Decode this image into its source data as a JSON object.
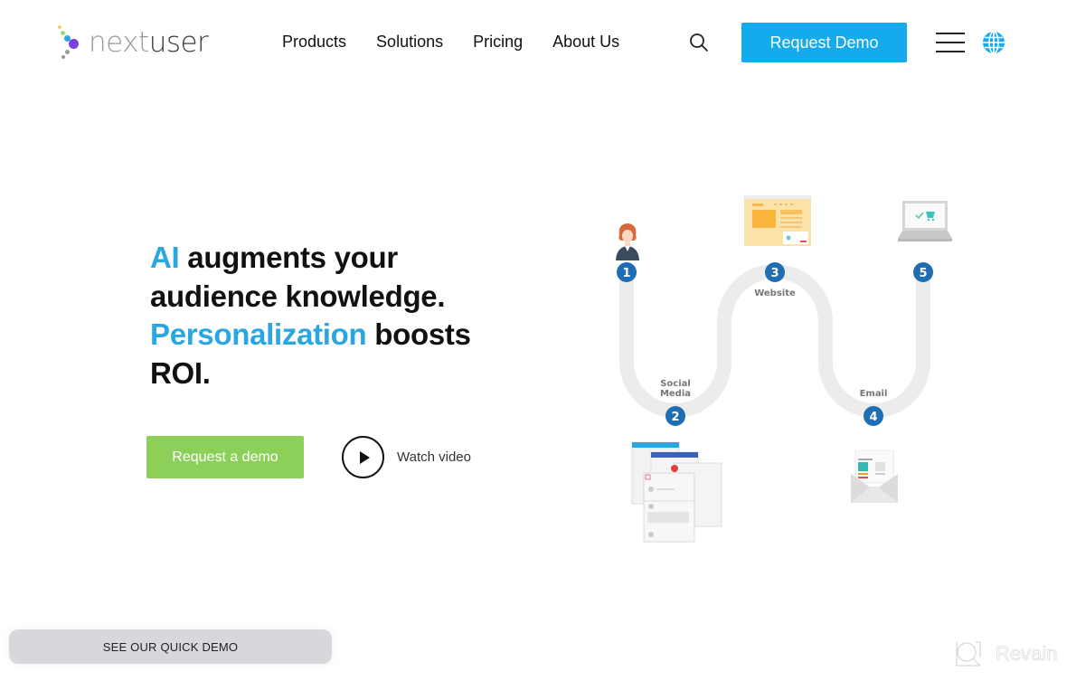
{
  "brand": {
    "name_part1": "next",
    "name_part2": "user",
    "dot_colors": [
      "#f6c343",
      "#8cd05a",
      "#2aa6e0",
      "#7b3fe4",
      "#9a9a9a",
      "#9a9a9a"
    ]
  },
  "header": {
    "nav": [
      {
        "label": "Products"
      },
      {
        "label": "Solutions"
      },
      {
        "label": "Pricing"
      },
      {
        "label": "About Us"
      }
    ],
    "search_icon": "search-icon",
    "request_demo_label": "Request Demo",
    "menu_icon": "hamburger-menu-icon",
    "language_icon": "globe-icon"
  },
  "hero": {
    "title_parts": [
      {
        "text": "AI",
        "accent": true
      },
      {
        "text": " augments your audience knowledge. ",
        "accent": false
      },
      {
        "text": "Personalization",
        "accent": true
      },
      {
        "text": " boosts ROI.",
        "accent": false
      }
    ],
    "cta_label": "Request a demo",
    "watch_label": "Watch video"
  },
  "journey": {
    "steps": [
      {
        "number": "1",
        "label": "",
        "illustration": "person-icon"
      },
      {
        "number": "2",
        "label": "Social Media",
        "illustration": "social-feeds-icon"
      },
      {
        "number": "3",
        "label": "Website",
        "illustration": "website-icon"
      },
      {
        "number": "4",
        "label": "Email",
        "illustration": "email-icon"
      },
      {
        "number": "5",
        "label": "",
        "illustration": "laptop-cart-icon"
      }
    ],
    "step_color": "#1f6db3",
    "path_color": "#ececec"
  },
  "footer": {
    "quick_demo_label": "SEE OUR QUICK DEMO",
    "watermark": "Revain"
  },
  "colors": {
    "accent_blue": "#2aa6e0",
    "button_blue": "#15aaeb",
    "button_green": "#8cd05a"
  }
}
